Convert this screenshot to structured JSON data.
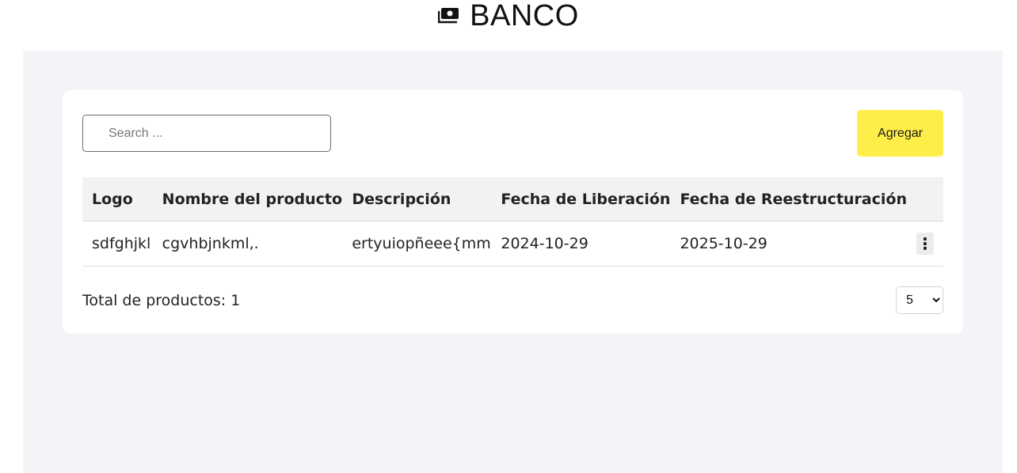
{
  "header": {
    "title": "BANCO",
    "icon": "money-bill-icon"
  },
  "toolbar": {
    "search_placeholder": "Search ...",
    "add_label": "Agregar"
  },
  "table": {
    "columns": [
      "Logo",
      "Nombre del producto",
      "Descripción",
      "Fecha de Liberación",
      "Fecha de Reestructuración"
    ],
    "rows": [
      {
        "logo": "sdfghjkl",
        "name": "cgvhbjnkml,.",
        "description": "ertyuiopñeee{mm",
        "release_date": "2024-10-29",
        "restructure_date": "2025-10-29",
        "menu_icon": "kebab-menu-icon",
        "menu_glyph": "⋮"
      }
    ]
  },
  "footer": {
    "total_label": "Total de productos: 1",
    "page_size_selected": "5",
    "page_size_options": [
      "5"
    ]
  },
  "colors": {
    "accent": "#ffee4a",
    "background": "#f3f4f7"
  }
}
